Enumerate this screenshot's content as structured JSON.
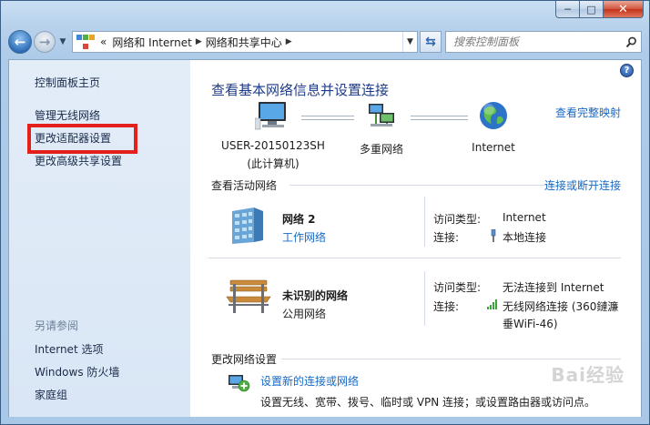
{
  "window": {
    "caption": {
      "min": "─",
      "max": "□",
      "close": "✕"
    }
  },
  "nav": {
    "address_chevron": "«",
    "breadcrumb": [
      "网络和 Internet",
      "网络和共享中心"
    ],
    "search_placeholder": "搜索控制面板"
  },
  "sidebar": {
    "items": [
      {
        "label": "控制面板主页"
      },
      {
        "label": "管理无线网络"
      },
      {
        "label": "更改适配器设置"
      },
      {
        "label": "更改高级共享设置"
      }
    ],
    "see_also_heading": "另请参阅",
    "see_also": [
      {
        "label": "Internet 选项"
      },
      {
        "label": "Windows 防火墙"
      },
      {
        "label": "家庭组"
      }
    ]
  },
  "main": {
    "title": "查看基本网络信息并设置连接",
    "full_map_link": "查看完整映射",
    "map": {
      "computer_line1": "USER-20150123SH",
      "computer_line2": "(此计算机)",
      "multi_network": "多重网络",
      "internet": "Internet"
    },
    "active": {
      "heading": "查看活动网络",
      "connect_link": "连接或断开连接",
      "networks": [
        {
          "name": "网络  2",
          "type": "工作网络",
          "access_label": "访问类型:",
          "access_value": "Internet",
          "conn_label": "连接:",
          "conn_value": "本地连接"
        },
        {
          "name": "未识别的网络",
          "type": "公用网络",
          "access_label": "访问类型:",
          "access_value": "无法连接到 Internet",
          "conn_label": "连接:",
          "conn_value_line1": "无线网络连接 (360鏈濂",
          "conn_value_line2": "垂WiFi-46)"
        }
      ]
    },
    "change": {
      "heading": "更改网络设置",
      "task_link": "设置新的连接或网络",
      "task_desc": "设置无线、宽带、拨号、临时或 VPN 连接；或设置路由器或访问点。"
    },
    "watermark": "Bai经验"
  }
}
